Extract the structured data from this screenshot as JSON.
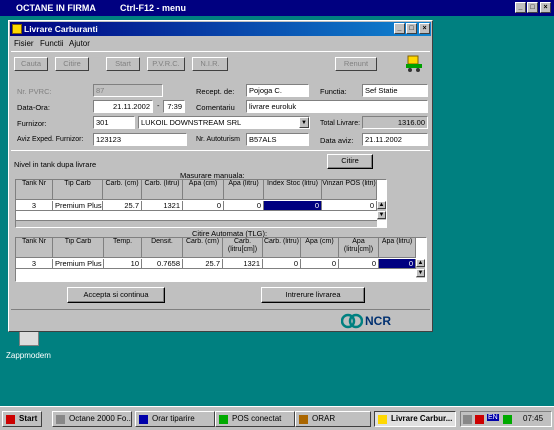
{
  "app": {
    "title": "OCTANE IN FIRMA",
    "subtitle": "Ctrl-F12 - menu"
  },
  "dialog": {
    "title": "Livrare Carburanti",
    "menu": [
      "Fisier",
      "Functii",
      "Ajutor"
    ],
    "toolbar": [
      "Cauta",
      "Citire",
      "Start",
      "P.V.R.C.",
      "N.I.R.",
      "Renunt"
    ]
  },
  "form": {
    "nr_pvrc": {
      "label": "Nr. PVRC:",
      "value": "87"
    },
    "recept_de": {
      "label": "Recept. de:",
      "value": "Pojoga C."
    },
    "functia": {
      "label": "Functia:",
      "value": "Sef Statie"
    },
    "data_ora": {
      "label": "Data-Ora:",
      "date": "21.11.2002",
      "time": "7:39"
    },
    "comentariu": {
      "label": "Comentariu",
      "value": "livrare euroluk"
    },
    "furnizor": {
      "label": "Furnizor:",
      "code": "301",
      "name": "LUKOIL DOWNSTREAM SRL"
    },
    "total_livrare": {
      "label": "Total Livrare:",
      "value": "1316.00"
    },
    "aviz_exped": {
      "label": "Aviz Exped. Furnizor:",
      "value": "123123"
    },
    "nr_autoturism": {
      "label": "Nr. Autoturism",
      "value": "B57ALS"
    },
    "data_aviz": {
      "label": "Data aviz:",
      "value": "21.11.2002"
    }
  },
  "nivel_label": "Nivel in tank dupa livrare",
  "citire_button": "Citire",
  "manual": {
    "title": "Masurare manuala:",
    "headers": [
      "Tank Nr",
      "Tip Carb",
      "Carb. (cm)",
      "Carb. (litru)",
      "Apa (cm)",
      "Apa (litru)",
      "Index Stoc (litru)",
      "Vinzari POS (litri)"
    ],
    "row": [
      "3",
      "Premium Plus",
      "25.7",
      "1321",
      "0",
      "0",
      "0",
      "0"
    ]
  },
  "tlg": {
    "title": "Citire Automata (TLG):",
    "headers": [
      "Tank Nr",
      "Tip Carb",
      "Temp.",
      "Densit.",
      "Carb. (cm)",
      "Carb. (litru[cm])",
      "Carb. (litru)",
      "Apa (cm)",
      "Apa (litru[cm])",
      "Apa (litru)"
    ],
    "row": [
      "3",
      "Premium Plus",
      "10",
      "0.7658",
      "25.7",
      "1321",
      "0",
      "0",
      "0",
      "0"
    ]
  },
  "buttons": {
    "accept": "Accepta si continua",
    "interrupt": "Intrerure livrarea"
  },
  "logo": "NCR",
  "desktop_icon": "Zappmodem",
  "taskbar": {
    "start": "Start",
    "tasks": [
      "Octane 2000 Fo...",
      "Orar tiparire",
      "POS conectat",
      "ORAR",
      "Livrare Carbur..."
    ],
    "clock": "07:45",
    "lang": "EN"
  },
  "colors": {
    "desktop": "#008080",
    "title": "#000080",
    "selection": "#000080"
  }
}
